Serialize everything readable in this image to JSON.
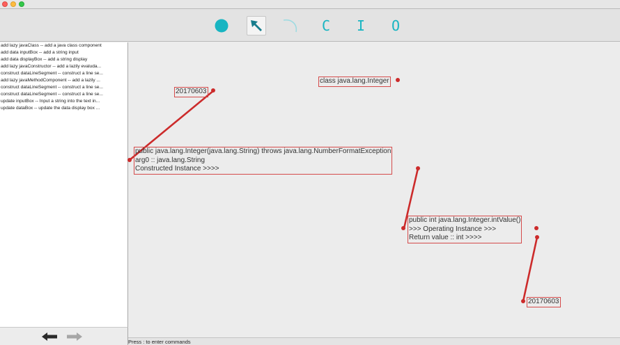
{
  "window": {
    "controls": [
      "close",
      "minimize",
      "zoom"
    ]
  },
  "toolbar": {
    "tools": [
      {
        "name": "circle-tool",
        "icon": "filled-circle-icon",
        "selected": false
      },
      {
        "name": "select-tool",
        "icon": "arrow-cursor-icon",
        "selected": true
      },
      {
        "name": "curve-tool",
        "icon": "curve-line-icon",
        "selected": false
      },
      {
        "name": "class-tool",
        "glyph": "C",
        "selected": false
      },
      {
        "name": "input-tool",
        "glyph": "I",
        "selected": false
      },
      {
        "name": "output-tool",
        "glyph": "O",
        "selected": false
      }
    ],
    "accent_color": "#18b5c2"
  },
  "commands": [
    "add lazy javaClass -- add a java class component",
    "add data inputBox -- add a string input",
    "add data displayBox -- add a string display",
    "add lazy javaConstructor -- add a lazily evaluda...",
    "construct dataLineSegment -- construct a line se...",
    "add lazy javaMethodComponent -- add a lazily ...",
    "construct dataLineSegment -- construct a line se...",
    "construct dataLineSegment -- construct a line se...",
    "update inputBox -- Input a string into the text in...",
    "update dataBox -- update the data display box ..."
  ],
  "nav": {
    "back_icon": "left-arrow-icon",
    "forward_icon": "right-arrow-icon"
  },
  "canvas": {
    "line_color": "#cc2b2b",
    "nodes": {
      "input_box": {
        "lines": [
          "20170603"
        ]
      },
      "class_box": {
        "lines": [
          "class java.lang.Integer"
        ]
      },
      "constructor_box": {
        "lines": [
          "public java.lang.Integer(java.lang.String) throws java.lang.NumberFormatException",
          "arg0 :: java.lang.String",
          "Constructed Instance >>>>"
        ]
      },
      "method_box": {
        "lines": [
          "public int java.lang.Integer.intValue()",
          ">>> Operating Instance  >>>",
          "Return value :: int >>>>"
        ]
      },
      "display_box": {
        "lines": [
          "20170603"
        ]
      }
    }
  },
  "status": {
    "text": "Press : to enter commands"
  }
}
